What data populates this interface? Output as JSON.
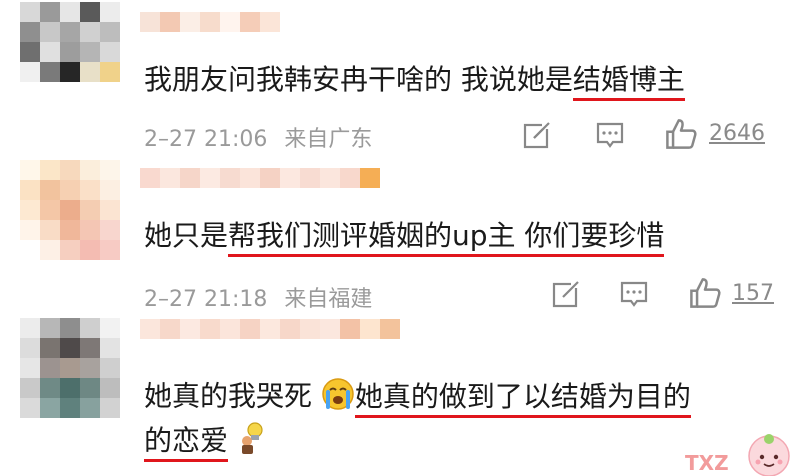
{
  "comments": [
    {
      "text1": "我朋友问我韩安冉干啥的 我说她是",
      "text_ul": "结婚博主",
      "time": "2–27 21:06",
      "location": "来自广东",
      "likes": "2646"
    },
    {
      "text1": "她只是",
      "text_ul": "帮我们测评婚姻的up主 你们要珍惜",
      "time": "2–27 21:18",
      "location": "来自福建",
      "likes": "157"
    },
    {
      "text1": "她真的我哭死",
      "text_ul": "她真的做到了以结婚为目的",
      "text_ul2": "的恋爱",
      "time": "",
      "location": "",
      "likes": ""
    }
  ],
  "icons": {
    "share": "share-icon",
    "comment": "comment-icon",
    "like": "thumbs-up-icon",
    "crying_emoji": "crying-face-icon",
    "lightbulb_emoji": "lightbulb-icon"
  },
  "colors": {
    "underline": "#e0161c",
    "meta": "#9a9a9a",
    "text": "#1a1a1a"
  }
}
